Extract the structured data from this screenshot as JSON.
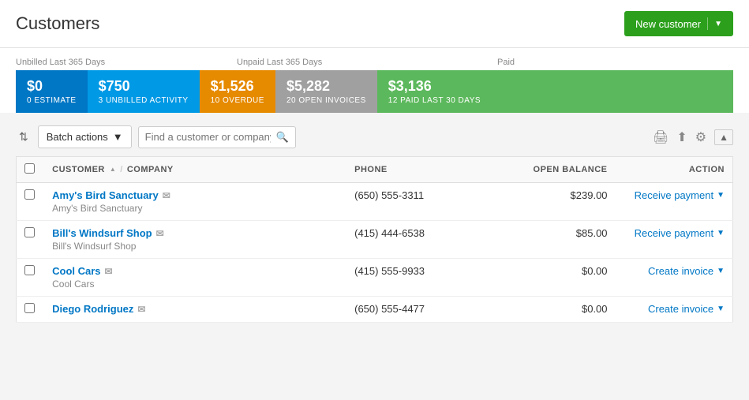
{
  "page": {
    "title": "Customers"
  },
  "header": {
    "new_customer_btn": "New customer"
  },
  "stats": {
    "unbilled_label": "Unbilled Last 365 Days",
    "unpaid_label": "Unpaid Last 365 Days",
    "paid_label": "Paid",
    "tiles": [
      {
        "amount": "$0",
        "label": "0 Estimate",
        "color": "blue"
      },
      {
        "amount": "$750",
        "label": "3 Unbilled Activity",
        "color": "blue2"
      },
      {
        "amount": "$1,526",
        "label": "10 Overdue",
        "color": "orange"
      },
      {
        "amount": "$5,282",
        "label": "20 Open Invoices",
        "color": "gray"
      },
      {
        "amount": "$3,136",
        "label": "12 Paid Last 30 Days",
        "color": "green"
      }
    ]
  },
  "toolbar": {
    "batch_actions_label": "Batch actions",
    "search_placeholder": "Find a customer or company"
  },
  "table": {
    "columns": [
      {
        "key": "check",
        "label": ""
      },
      {
        "key": "customer",
        "label": "CUSTOMER",
        "sort": true,
        "secondary": "/ COMPANY"
      },
      {
        "key": "phone",
        "label": "PHONE"
      },
      {
        "key": "balance",
        "label": "OPEN BALANCE",
        "align": "right"
      },
      {
        "key": "action",
        "label": "ACTION",
        "align": "right"
      }
    ],
    "rows": [
      {
        "name": "Amy's Bird Sanctuary",
        "company": "Amy's Bird Sanctuary",
        "phone": "(650) 555-3311",
        "balance": "$239.00",
        "action": "Receive payment"
      },
      {
        "name": "Bill's Windsurf Shop",
        "company": "Bill's Windsurf Shop",
        "phone": "(415) 444-6538",
        "balance": "$85.00",
        "action": "Receive payment"
      },
      {
        "name": "Cool Cars",
        "company": "Cool Cars",
        "phone": "(415) 555-9933",
        "balance": "$0.00",
        "action": "Create invoice"
      },
      {
        "name": "Diego Rodriguez",
        "company": "",
        "phone": "(650) 555-4477",
        "balance": "$0.00",
        "action": "Create invoice"
      }
    ]
  }
}
